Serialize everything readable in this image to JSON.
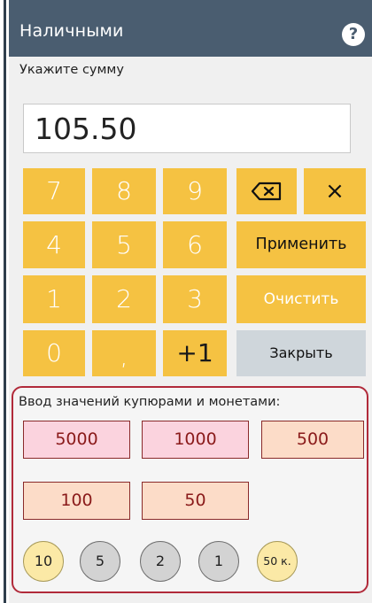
{
  "header": {
    "title": "Наличными",
    "help_label": "?"
  },
  "prompt": "Укажите сумму",
  "amount": "105.50",
  "keypad": {
    "keys": [
      "7",
      "8",
      "9",
      "4",
      "5",
      "6",
      "1",
      "2",
      "3",
      "0",
      ",",
      "+1"
    ]
  },
  "actions": {
    "clear_x": "×",
    "apply": "Применить",
    "clear": "Очистить",
    "close": "Закрыть"
  },
  "denominations": {
    "label": "Ввод значений купюрами и монетами:",
    "notes": [
      "5000",
      "1000",
      "500",
      "100",
      "50"
    ],
    "coins": [
      "10",
      "5",
      "2",
      "1",
      "50 к."
    ]
  },
  "colors": {
    "header_bg": "#4a5d70",
    "key_yellow": "#f5c242",
    "close_bg": "#cfd6db",
    "group_border": "#b12a3a",
    "note_pink": "#fbd3de",
    "note_peach": "#fcdcc8",
    "coin_gold": "#fbe9a6",
    "coin_grey": "#d3d3d3"
  },
  "icons": {
    "backspace": "backspace-icon",
    "help": "help-icon",
    "close_x": "close-icon"
  }
}
